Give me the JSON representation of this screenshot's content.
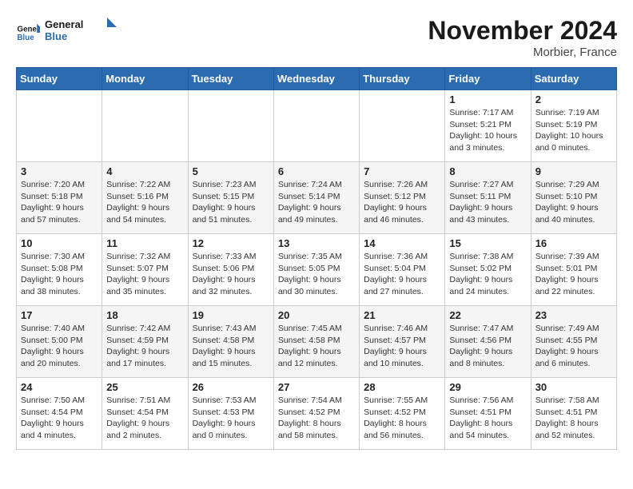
{
  "logo": {
    "line1": "General",
    "line2": "Blue"
  },
  "title": "November 2024",
  "location": "Morbier, France",
  "weekdays": [
    "Sunday",
    "Monday",
    "Tuesday",
    "Wednesday",
    "Thursday",
    "Friday",
    "Saturday"
  ],
  "weeks": [
    [
      {
        "day": "",
        "info": ""
      },
      {
        "day": "",
        "info": ""
      },
      {
        "day": "",
        "info": ""
      },
      {
        "day": "",
        "info": ""
      },
      {
        "day": "",
        "info": ""
      },
      {
        "day": "1",
        "info": "Sunrise: 7:17 AM\nSunset: 5:21 PM\nDaylight: 10 hours and 3 minutes."
      },
      {
        "day": "2",
        "info": "Sunrise: 7:19 AM\nSunset: 5:19 PM\nDaylight: 10 hours and 0 minutes."
      }
    ],
    [
      {
        "day": "3",
        "info": "Sunrise: 7:20 AM\nSunset: 5:18 PM\nDaylight: 9 hours and 57 minutes."
      },
      {
        "day": "4",
        "info": "Sunrise: 7:22 AM\nSunset: 5:16 PM\nDaylight: 9 hours and 54 minutes."
      },
      {
        "day": "5",
        "info": "Sunrise: 7:23 AM\nSunset: 5:15 PM\nDaylight: 9 hours and 51 minutes."
      },
      {
        "day": "6",
        "info": "Sunrise: 7:24 AM\nSunset: 5:14 PM\nDaylight: 9 hours and 49 minutes."
      },
      {
        "day": "7",
        "info": "Sunrise: 7:26 AM\nSunset: 5:12 PM\nDaylight: 9 hours and 46 minutes."
      },
      {
        "day": "8",
        "info": "Sunrise: 7:27 AM\nSunset: 5:11 PM\nDaylight: 9 hours and 43 minutes."
      },
      {
        "day": "9",
        "info": "Sunrise: 7:29 AM\nSunset: 5:10 PM\nDaylight: 9 hours and 40 minutes."
      }
    ],
    [
      {
        "day": "10",
        "info": "Sunrise: 7:30 AM\nSunset: 5:08 PM\nDaylight: 9 hours and 38 minutes."
      },
      {
        "day": "11",
        "info": "Sunrise: 7:32 AM\nSunset: 5:07 PM\nDaylight: 9 hours and 35 minutes."
      },
      {
        "day": "12",
        "info": "Sunrise: 7:33 AM\nSunset: 5:06 PM\nDaylight: 9 hours and 32 minutes."
      },
      {
        "day": "13",
        "info": "Sunrise: 7:35 AM\nSunset: 5:05 PM\nDaylight: 9 hours and 30 minutes."
      },
      {
        "day": "14",
        "info": "Sunrise: 7:36 AM\nSunset: 5:04 PM\nDaylight: 9 hours and 27 minutes."
      },
      {
        "day": "15",
        "info": "Sunrise: 7:38 AM\nSunset: 5:02 PM\nDaylight: 9 hours and 24 minutes."
      },
      {
        "day": "16",
        "info": "Sunrise: 7:39 AM\nSunset: 5:01 PM\nDaylight: 9 hours and 22 minutes."
      }
    ],
    [
      {
        "day": "17",
        "info": "Sunrise: 7:40 AM\nSunset: 5:00 PM\nDaylight: 9 hours and 20 minutes."
      },
      {
        "day": "18",
        "info": "Sunrise: 7:42 AM\nSunset: 4:59 PM\nDaylight: 9 hours and 17 minutes."
      },
      {
        "day": "19",
        "info": "Sunrise: 7:43 AM\nSunset: 4:58 PM\nDaylight: 9 hours and 15 minutes."
      },
      {
        "day": "20",
        "info": "Sunrise: 7:45 AM\nSunset: 4:58 PM\nDaylight: 9 hours and 12 minutes."
      },
      {
        "day": "21",
        "info": "Sunrise: 7:46 AM\nSunset: 4:57 PM\nDaylight: 9 hours and 10 minutes."
      },
      {
        "day": "22",
        "info": "Sunrise: 7:47 AM\nSunset: 4:56 PM\nDaylight: 9 hours and 8 minutes."
      },
      {
        "day": "23",
        "info": "Sunrise: 7:49 AM\nSunset: 4:55 PM\nDaylight: 9 hours and 6 minutes."
      }
    ],
    [
      {
        "day": "24",
        "info": "Sunrise: 7:50 AM\nSunset: 4:54 PM\nDaylight: 9 hours and 4 minutes."
      },
      {
        "day": "25",
        "info": "Sunrise: 7:51 AM\nSunset: 4:54 PM\nDaylight: 9 hours and 2 minutes."
      },
      {
        "day": "26",
        "info": "Sunrise: 7:53 AM\nSunset: 4:53 PM\nDaylight: 9 hours and 0 minutes."
      },
      {
        "day": "27",
        "info": "Sunrise: 7:54 AM\nSunset: 4:52 PM\nDaylight: 8 hours and 58 minutes."
      },
      {
        "day": "28",
        "info": "Sunrise: 7:55 AM\nSunset: 4:52 PM\nDaylight: 8 hours and 56 minutes."
      },
      {
        "day": "29",
        "info": "Sunrise: 7:56 AM\nSunset: 4:51 PM\nDaylight: 8 hours and 54 minutes."
      },
      {
        "day": "30",
        "info": "Sunrise: 7:58 AM\nSunset: 4:51 PM\nDaylight: 8 hours and 52 minutes."
      }
    ]
  ]
}
